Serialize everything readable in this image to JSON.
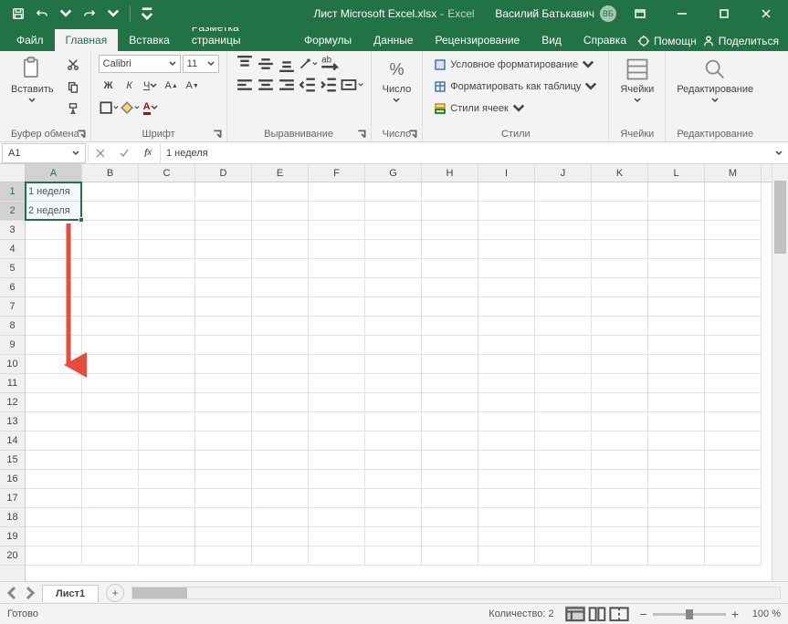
{
  "title": {
    "doc": "Лист Microsoft Excel.xlsx",
    "app": "Excel"
  },
  "user": {
    "name": "Василий Батькавич",
    "initials": "ВБ"
  },
  "tabs": {
    "file": "Файл",
    "items": [
      "Главная",
      "Вставка",
      "Разметка страницы",
      "Формулы",
      "Данные",
      "Рецензирование",
      "Вид",
      "Справка"
    ],
    "active": 0,
    "help": "Помощн",
    "share": "Поделиться"
  },
  "ribbon": {
    "clipboard": {
      "label": "Буфер обмена",
      "paste": "Вставить"
    },
    "font": {
      "label": "Шрифт",
      "name": "Calibri",
      "size": "11",
      "bold": "Ж",
      "italic": "К",
      "underline": "Ч"
    },
    "alignment": {
      "label": "Выравнивание"
    },
    "number": {
      "label": "Число"
    },
    "styles": {
      "label": "Стили",
      "cond": "Условное форматирование",
      "table": "Форматировать как таблицу",
      "cell": "Стили ячеек"
    },
    "cells": {
      "label": "Ячейки"
    },
    "editing": {
      "label": "Редактирование"
    }
  },
  "formula": {
    "ref": "A1",
    "value": "1 неделя"
  },
  "grid": {
    "columns": [
      "A",
      "B",
      "C",
      "D",
      "E",
      "F",
      "G",
      "H",
      "I",
      "J",
      "K",
      "L",
      "M"
    ],
    "rows": 20,
    "selectedCols": [
      "A"
    ],
    "selectedRows": [
      1,
      2
    ],
    "data": {
      "A1": "1 неделя",
      "A2": "2 неделя"
    },
    "selection": {
      "startRow": 1,
      "endRow": 2,
      "startCol": 0,
      "endCol": 0
    }
  },
  "sheets": {
    "active": "Лист1"
  },
  "status": {
    "ready": "Готово",
    "count_label": "Количество:",
    "count": "2",
    "zoom": "100 %"
  }
}
